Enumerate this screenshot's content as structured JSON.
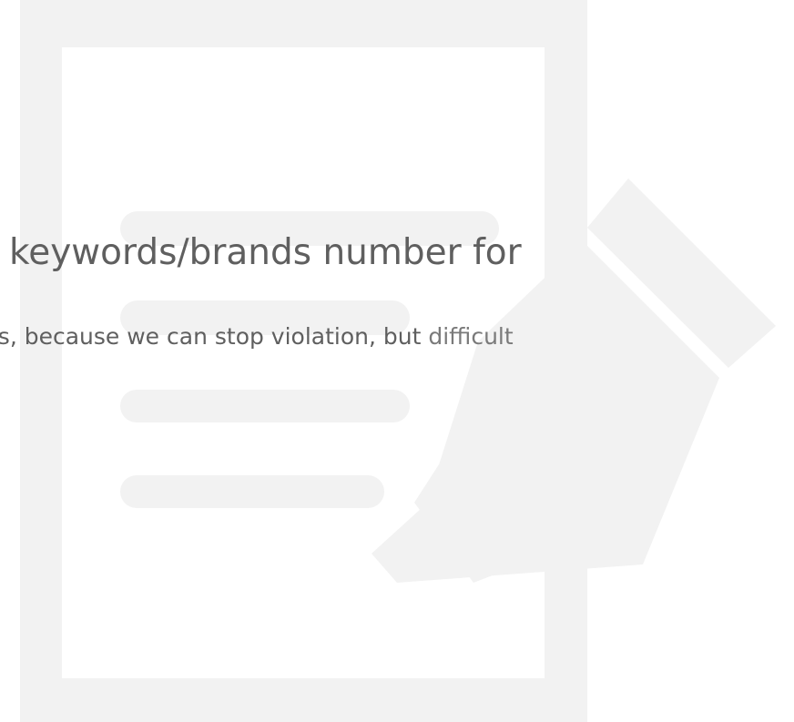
{
  "watermark": {
    "icon": "document-with-pen-icon",
    "color": "#f2f2f2"
  },
  "top_line": {
    "text": ""
  },
  "headline": {
    "text": "keywords/brands number for"
  },
  "body": {
    "text": "ts, because we can stop violation, but",
    "trailing": "difficult"
  },
  "colors": {
    "text": "#5f5f5f",
    "muted": "#7a7a7a",
    "background": "#ffffff"
  }
}
